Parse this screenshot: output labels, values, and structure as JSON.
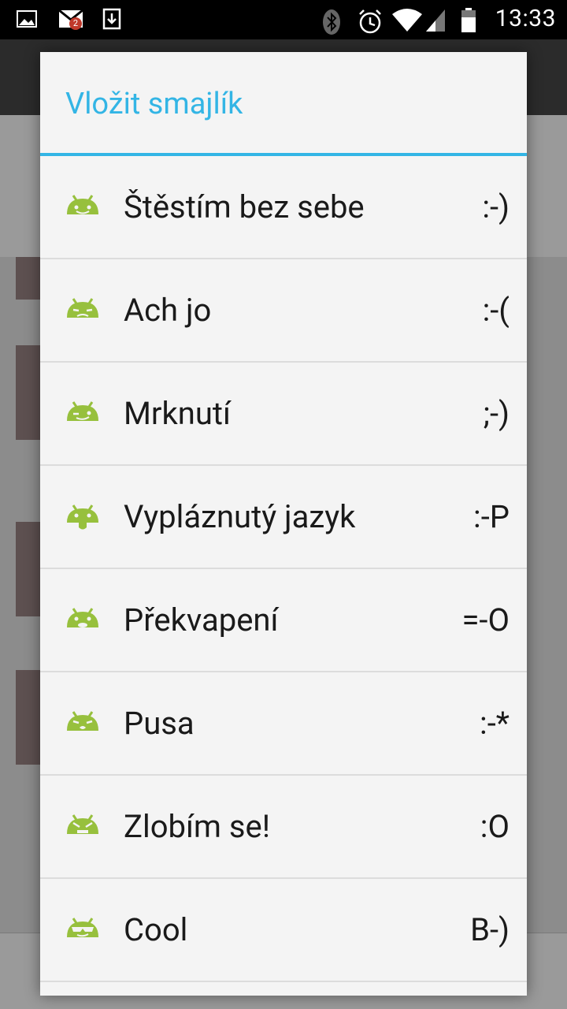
{
  "status_bar": {
    "time": "13:33",
    "gmail_badge": "2",
    "left_icons": [
      "image-icon",
      "gmail-icon",
      "download-icon"
    ],
    "right_icons": [
      "bluetooth-icon",
      "alarm-icon",
      "wifi-icon",
      "signal-icon",
      "battery-icon"
    ]
  },
  "dialog": {
    "title": "Vložit smajlík",
    "accent_color": "#33b5e5",
    "items": [
      {
        "label": "Štěstím bez sebe",
        "code": ":-)",
        "icon": "happy-android-icon"
      },
      {
        "label": "Ach jo",
        "code": ":-(",
        "icon": "sad-android-icon"
      },
      {
        "label": "Mrknutí",
        "code": ";-)",
        "icon": "wink-android-icon"
      },
      {
        "label": "Vypláznutý jazyk",
        "code": ":-P",
        "icon": "tongue-android-icon"
      },
      {
        "label": "Překvapení",
        "code": "=-O",
        "icon": "surprised-android-icon"
      },
      {
        "label": "Pusa",
        "code": ":-*",
        "icon": "kiss-android-icon"
      },
      {
        "label": "Zlobím se!",
        "code": ":O",
        "icon": "angry-android-icon"
      },
      {
        "label": "Cool",
        "code": "B-)",
        "icon": "cool-android-icon"
      }
    ]
  },
  "colors": {
    "android_green": "#97c03d",
    "title_blue": "#33b5e5"
  }
}
